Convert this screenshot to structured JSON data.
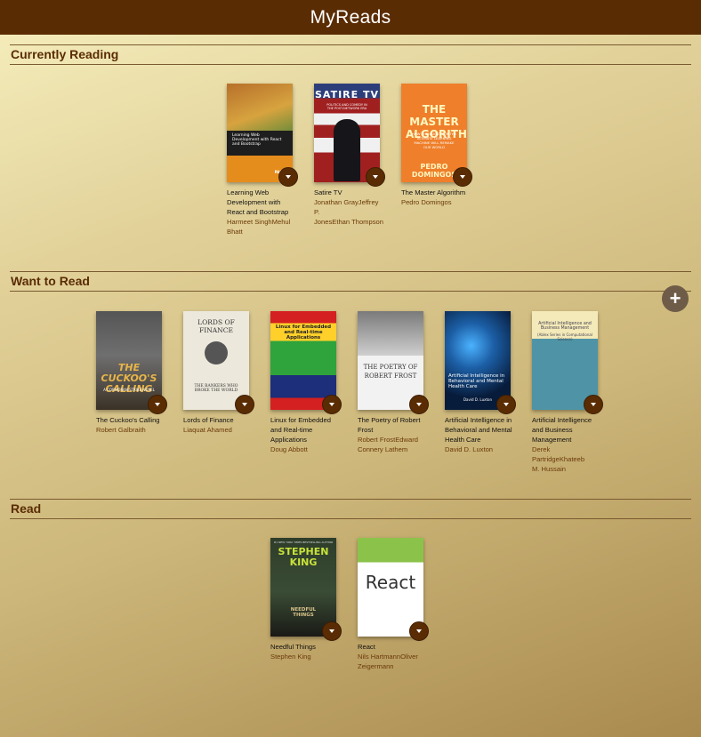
{
  "header": {
    "title": "MyReads"
  },
  "shelves": [
    {
      "title": "Currently Reading",
      "books": [
        {
          "title": "Learning Web Development with React and Bootstrap",
          "authors": [
            "Harmeet Singh",
            "Mehul Bhatt"
          ]
        },
        {
          "title": "Satire TV",
          "authors": [
            "Jonathan Gray",
            "Jeffrey P. Jones",
            "Ethan Thompson"
          ]
        },
        {
          "title": "The Master Algorithm",
          "authors": [
            "Pedro Domingos"
          ]
        }
      ]
    },
    {
      "title": "Want to Read",
      "books": [
        {
          "title": "The Cuckoo's Calling",
          "authors": [
            "Robert Galbraith"
          ]
        },
        {
          "title": "Lords of Finance",
          "authors": [
            "Liaquat Ahamed"
          ]
        },
        {
          "title": "Linux for Embedded and Real-time Applications",
          "authors": [
            "Doug Abbott"
          ]
        },
        {
          "title": "The Poetry of Robert Frost",
          "authors": [
            "Robert Frost",
            "Edward Connery Lathem"
          ]
        },
        {
          "title": "Artificial Intelligence in Behavioral and Mental Health Care",
          "authors": [
            "David D. Luxton"
          ]
        },
        {
          "title": "Artificial Intelligence and Business Management",
          "authors": [
            "Derek Partridge",
            "Khateeb M. Hussain"
          ]
        }
      ]
    },
    {
      "title": "Read",
      "books": [
        {
          "title": "Needful Things",
          "authors": [
            "Stephen King"
          ]
        },
        {
          "title": "React",
          "authors": [
            "Nils Hartmann",
            "Oliver Zeigermann"
          ]
        }
      ]
    }
  ],
  "author_lines": {
    "s0b0": [
      "Harmeet SinghMehul",
      "Bhatt"
    ],
    "s0b1": [
      "Jonathan GrayJeffrey P.",
      "JonesEthan Thompson"
    ],
    "s0b2": [
      "Pedro Domingos"
    ],
    "s1b0": [
      "Robert Galbraith"
    ],
    "s1b1": [
      "Liaquat Ahamed"
    ],
    "s1b2": [
      "Doug Abbott"
    ],
    "s1b3": [
      "Robert FrostEdward",
      "Connery Lathem"
    ],
    "s1b4": [
      "David D. Luxton"
    ],
    "s1b5": [
      "Derek PartridgeKhateeb",
      "M. Hussain"
    ],
    "s2b0": [
      "Stephen King"
    ],
    "s2b1": [
      "Nils HartmannOliver",
      "Zeigermann"
    ]
  },
  "covers": {
    "webdev": {
      "main": "Learning Web Development with React and Bootstrap",
      "publisher": "PACKT"
    },
    "satire": {
      "main": "SATIRE TV",
      "sub": "POLITICS AND COMEDY IN THE POST-NETWORK ERA"
    },
    "master": {
      "main": "THE MASTER ALGORITHM",
      "sub": "HOW THE QUEST FOR THE ULTIMATE LEARNING MACHINE WILL REMAKE OUR WORLD",
      "author": "PEDRO DOMINGOS"
    },
    "cuckoo": {
      "main": "THE CUCKOO'S CALLING",
      "sub": "A CORMORAN STRIKE NOVEL"
    },
    "lords": {
      "main": "LORDS OF FINANCE",
      "sub": "THE BANKERS WHO BROKE THE WORLD"
    },
    "linux": {
      "main": "Linux for Embedded and Real-time Applications"
    },
    "frost": {
      "main": "THE POETRY OF ROBERT FROST"
    },
    "ai": {
      "main": "Artificial Intelligence in Behavioral and Mental Health Care",
      "author": "David D. Luxton"
    },
    "aibm": {
      "main": "Artificial Intelligence and Business Management",
      "sub": "(Ablex Series in Computational Science)"
    },
    "king": {
      "top": "#1 NEW YORK TIMES BESTSELLING AUTHOR",
      "main": "STEPHEN KING",
      "sub": "NEEDFUL THINGS"
    },
    "react": {
      "main": "React"
    }
  },
  "colors": {
    "header": "#5a2c04",
    "accent": "#5a2c04",
    "author": "#6b3a0a",
    "add_button": "#6f5c48"
  },
  "icons": {
    "shelf_changer": "triangle-down-icon",
    "add": "plus-icon"
  }
}
